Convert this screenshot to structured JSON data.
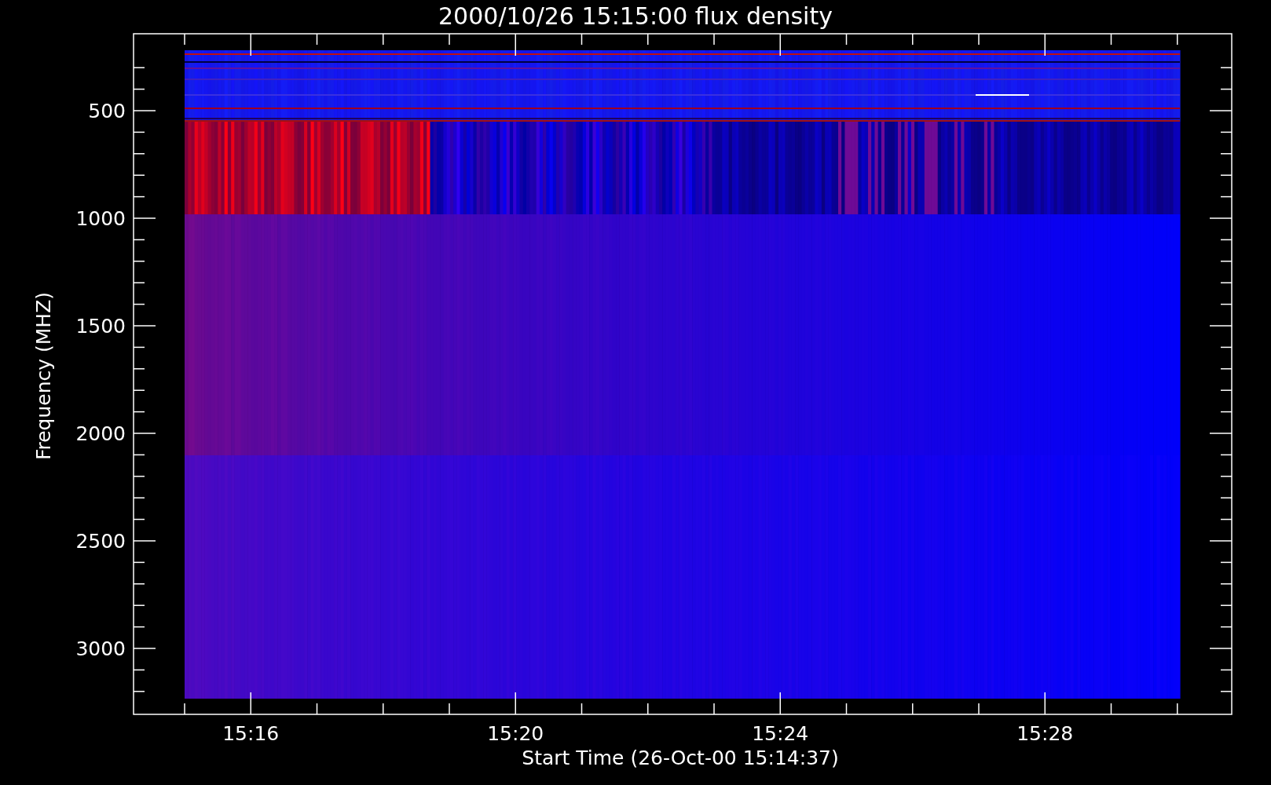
{
  "plot": {
    "title": "2000/10/26 15:15:00 flux density",
    "xlabel": "Start Time (26-Oct-00 15:14:37)",
    "ylabel": "Frequency (MHZ)",
    "x_tick_labels": [
      "15:16",
      "15:20",
      "15:24",
      "15:28"
    ],
    "y_tick_labels": [
      "500",
      "1000",
      "1500",
      "2000",
      "2500",
      "3000"
    ]
  }
}
